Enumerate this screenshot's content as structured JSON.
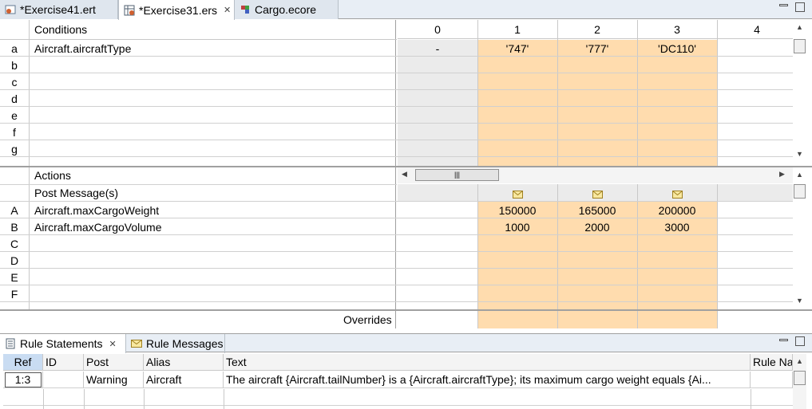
{
  "editor_tabs": [
    {
      "label": "*Exercise41.ert",
      "icon": "rule-test-icon"
    },
    {
      "label": "*Exercise31.ers",
      "icon": "rule-sheet-icon"
    },
    {
      "label": "Cargo.ecore",
      "icon": "ecore-model-icon"
    }
  ],
  "conditions": {
    "header": "Conditions",
    "rows": [
      {
        "letter": "a",
        "expr": "Aircraft.aircraftType"
      },
      {
        "letter": "b",
        "expr": ""
      },
      {
        "letter": "c",
        "expr": ""
      },
      {
        "letter": "d",
        "expr": ""
      },
      {
        "letter": "e",
        "expr": ""
      },
      {
        "letter": "f",
        "expr": ""
      },
      {
        "letter": "g",
        "expr": ""
      }
    ]
  },
  "columns": [
    "0",
    "1",
    "2",
    "3",
    "4"
  ],
  "condition_values": {
    "a": [
      "-",
      "'747'",
      "'777'",
      "'DC110'",
      ""
    ]
  },
  "actions": {
    "header": "Actions",
    "post_message_label": "Post Message(s)",
    "rows": [
      {
        "letter": "A",
        "expr": "Aircraft.maxCargoWeight",
        "values": [
          "",
          "150000",
          "165000",
          "200000",
          ""
        ]
      },
      {
        "letter": "B",
        "expr": "Aircraft.maxCargoVolume",
        "values": [
          "",
          "1000",
          "2000",
          "3000",
          ""
        ]
      },
      {
        "letter": "C",
        "expr": "",
        "values": []
      },
      {
        "letter": "D",
        "expr": "",
        "values": []
      },
      {
        "letter": "E",
        "expr": "",
        "values": []
      },
      {
        "letter": "F",
        "expr": "",
        "values": []
      }
    ],
    "overrides_label": "Overrides"
  },
  "bottom_panel": {
    "tabs": [
      {
        "label": "Rule Statements",
        "icon": "rule-statements-icon"
      },
      {
        "label": "Rule Messages",
        "icon": "envelope-icon"
      }
    ],
    "columns": [
      "Ref",
      "ID",
      "Post",
      "Alias",
      "Text",
      "Rule Na"
    ],
    "rows": [
      {
        "ref": "1:3",
        "id": "",
        "post": "Warning",
        "alias": "Aircraft",
        "text": "The aircraft {Aircraft.tailNumber} is a {Aircraft.aircraftType}; its maximum cargo weight equals {Ai...",
        "rule_name": ""
      }
    ]
  },
  "colors": {
    "peach": "#ffdcae",
    "gray": "#ebebeb",
    "selected_header": "#c9dcf2"
  }
}
